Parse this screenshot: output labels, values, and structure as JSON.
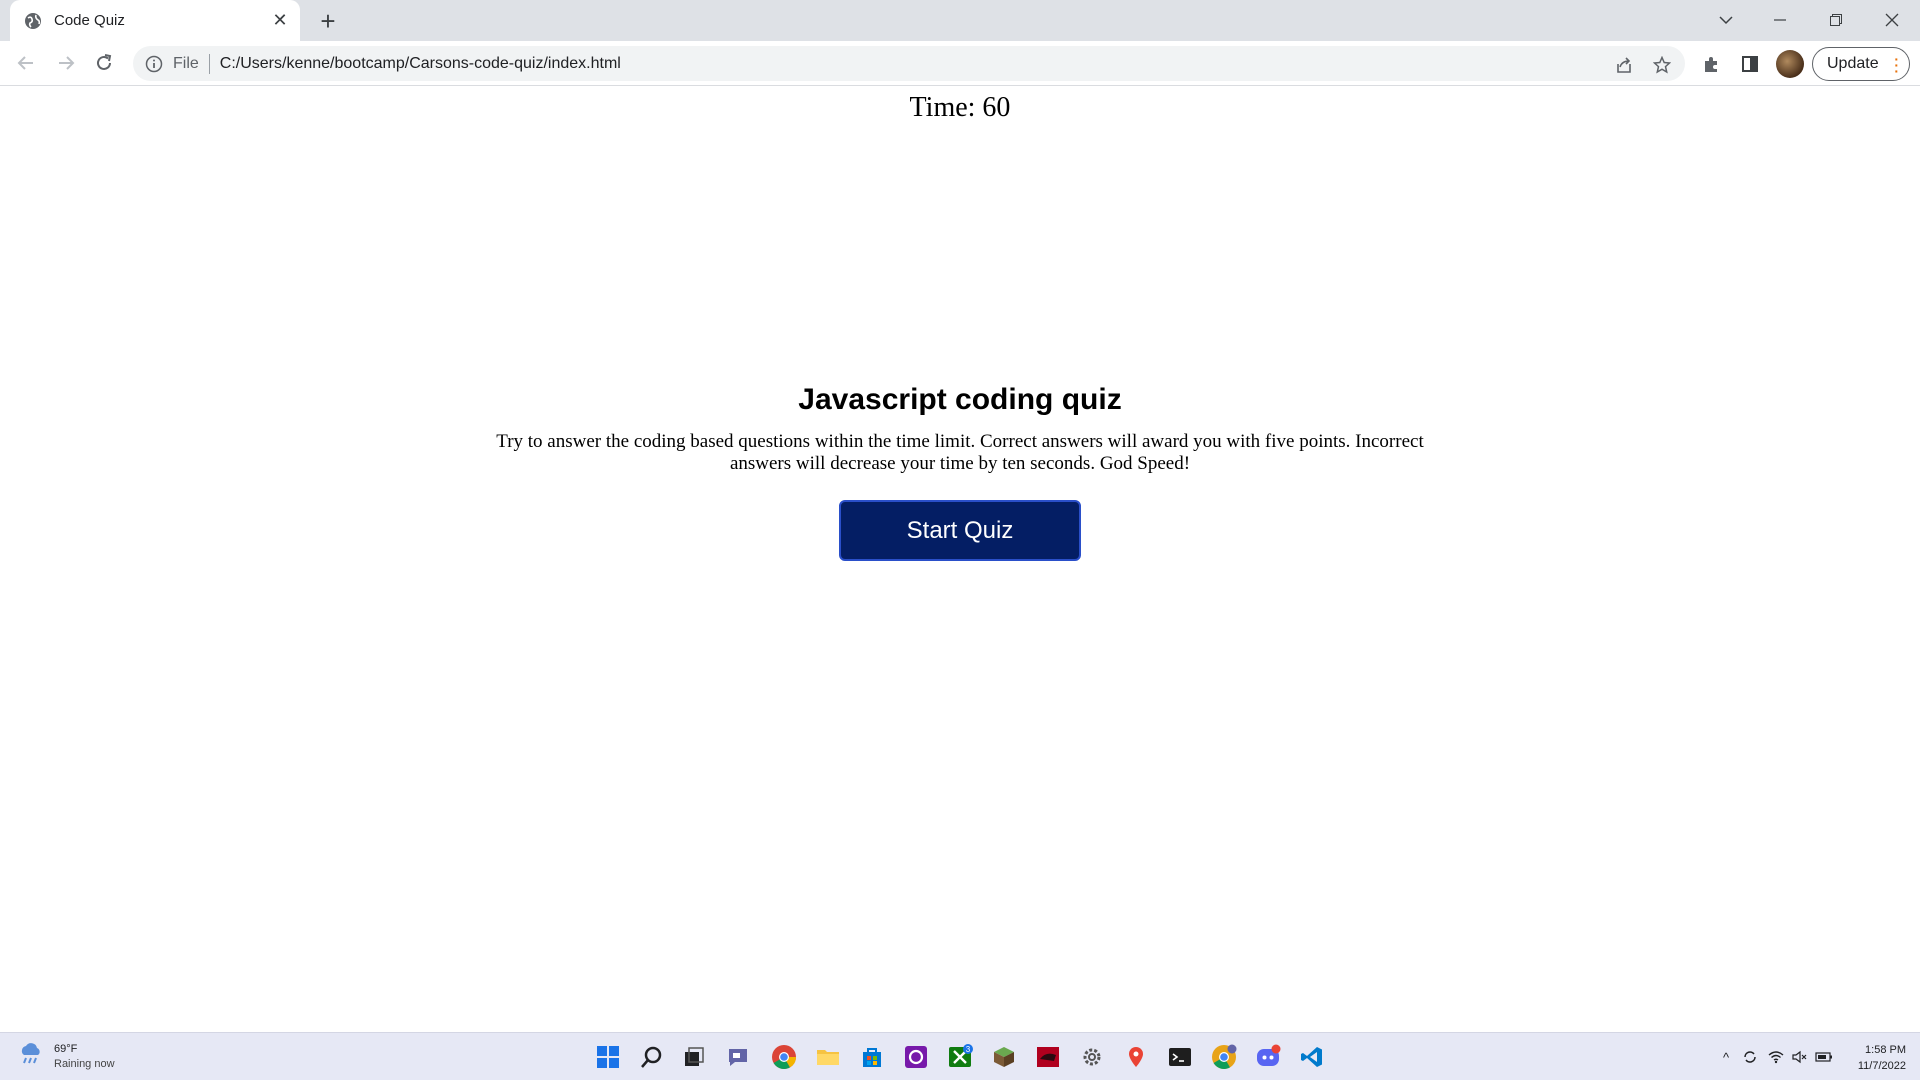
{
  "browser": {
    "tab_title": "Code Quiz",
    "address_prefix": "File",
    "url": "C:/Users/kenne/bootcamp/Carsons-code-quiz/index.html",
    "update_label": "Update"
  },
  "page": {
    "timer_text": "Time: 60",
    "heading": "Javascript coding quiz",
    "description": "Try to answer the coding based questions within the time limit. Correct answers will award you with five points. Incorrect answers will decrease your time by ten seconds. God Speed!",
    "start_button_label": "Start Quiz"
  },
  "taskbar": {
    "weather_temp": "69°F",
    "weather_status": "Raining now",
    "time": "1:58 PM",
    "date": "11/7/2022",
    "apps": [
      "windows-start",
      "search",
      "task-view",
      "teams-chat",
      "chrome",
      "file-explorer",
      "microsoft-store",
      "app-purple",
      "xbox",
      "minecraft",
      "app-red",
      "settings",
      "maps",
      "terminal",
      "chrome-canary",
      "discord",
      "vscode"
    ],
    "xbox_badge": "3"
  },
  "colors": {
    "button_bg": "#041e64",
    "button_border": "#2a4fc9"
  }
}
